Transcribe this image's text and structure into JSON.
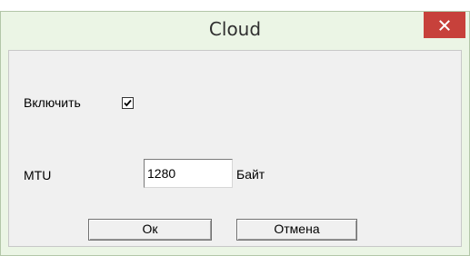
{
  "window": {
    "title": "Cloud",
    "close_icon": "close-icon",
    "close_color": "#c7413b"
  },
  "form": {
    "enable_label": "Включить",
    "enable_checked": true,
    "mtu_label": "MTU",
    "mtu_value": "1280",
    "mtu_unit": "Байт"
  },
  "buttons": {
    "ok_label": "Ок",
    "cancel_label": "Отмена"
  }
}
